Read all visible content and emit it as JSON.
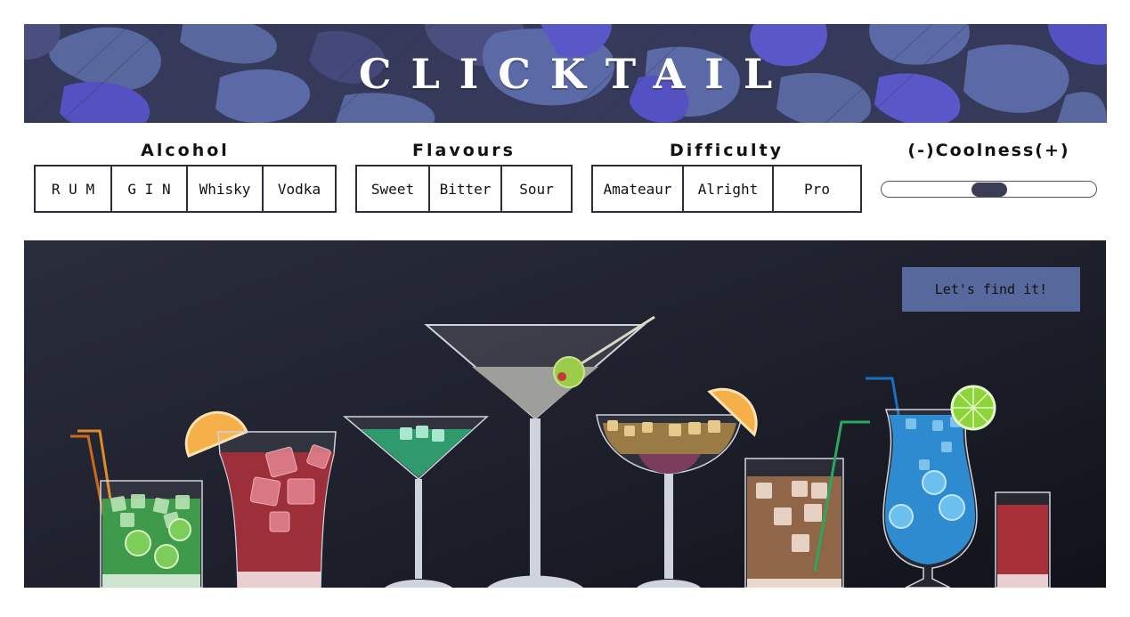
{
  "app": {
    "title": "CLICKTAIL"
  },
  "filters": {
    "alcohol": {
      "title": "Alcohol",
      "options": [
        "R U M",
        "G I N",
        "Whisky",
        "Vodka"
      ]
    },
    "flavours": {
      "title": "Flavours",
      "options": [
        "Sweet",
        "Bitter",
        "Sour"
      ]
    },
    "difficulty": {
      "title": "Difficulty",
      "options": [
        "Amateaur",
        "Alright",
        "Pro"
      ]
    },
    "coolness": {
      "title": "(-)Coolness(+)",
      "value_fraction": 0.5
    }
  },
  "actions": {
    "find_label": "Let's find it!"
  },
  "colors": {
    "banner_bg": "#3b3f63",
    "banner_blob_light": "#5b6aa6",
    "banner_blob_violet": "#5a57c8",
    "scene_bg": "#1d1f2b",
    "find_button": "#56689c",
    "slider_thumb": "#3a3d55"
  },
  "icons": [
    "cocktail-glasses-illustration",
    "lime-slice-icon",
    "orange-slice-icon",
    "olive-icon",
    "straw-icon"
  ]
}
